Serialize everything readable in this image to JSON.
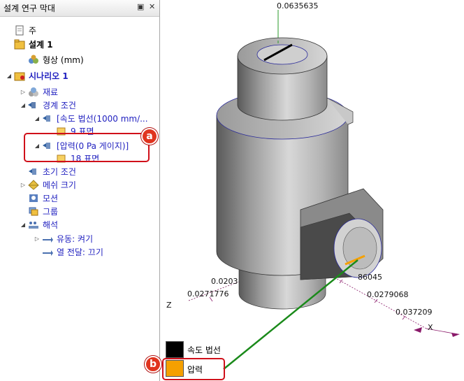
{
  "panel": {
    "title": "설계 연구 막대",
    "pin_icon": "pin-icon",
    "close_glyph": "✕",
    "tree": [
      {
        "label": "주",
        "icon": "document-icon",
        "indent": 0,
        "toggle": ""
      },
      {
        "label": "설계 1",
        "icon": "design-folder-icon",
        "indent": 0,
        "toggle": "",
        "bold": true
      },
      {
        "label": "형상 (mm)",
        "icon": "geometry-icon",
        "indent": 1,
        "toggle": ""
      },
      {
        "label": "시나리오 1",
        "icon": "scenario-icon",
        "indent": 0,
        "toggle": "▲",
        "bold": true,
        "blue": true
      },
      {
        "label": "재료",
        "icon": "materials-icon",
        "indent": 1,
        "toggle": "▷",
        "blue": true
      },
      {
        "label": "경계 조건",
        "icon": "boundary-icon",
        "indent": 1,
        "toggle": "▲",
        "blue": true
      },
      {
        "label": "[속도 법선(1000 mm/...",
        "icon": "boundary-condition-icon",
        "indent": 2,
        "toggle": "▲",
        "blue": true
      },
      {
        "label": "9 표면",
        "icon": "surface-icon",
        "indent": 3,
        "toggle": "",
        "blue": true
      },
      {
        "label": "[압력(0 Pa 게이지)]",
        "icon": "boundary-condition-icon",
        "indent": 2,
        "toggle": "▲",
        "blue": true
      },
      {
        "label": "18 표면",
        "icon": "surface-icon",
        "indent": 3,
        "toggle": "",
        "blue": true
      },
      {
        "label": "초기 조건",
        "icon": "initial-condition-icon",
        "indent": 1,
        "toggle": "",
        "blue": true
      },
      {
        "label": "메쉬 크기",
        "icon": "mesh-icon",
        "indent": 1,
        "toggle": "▷",
        "blue": true
      },
      {
        "label": "모션",
        "icon": "motion-icon",
        "indent": 1,
        "toggle": "",
        "blue": true
      },
      {
        "label": "그룹",
        "icon": "groups-icon",
        "indent": 1,
        "toggle": "",
        "blue": true
      },
      {
        "label": "해석",
        "icon": "solve-icon",
        "indent": 1,
        "toggle": "▲",
        "blue": true
      },
      {
        "label": "유동: 켜기",
        "icon": "flow-icon",
        "indent": 2,
        "toggle": "▷",
        "blue": true
      },
      {
        "label": "열 전달: 끄기",
        "icon": "heat-transfer-icon",
        "indent": 2,
        "toggle": "",
        "blue": true
      }
    ]
  },
  "callouts": {
    "a": "a",
    "b": "b"
  },
  "viewport": {
    "axis_labels": [
      "0.0635635",
      "0.0203",
      "0.0271776",
      "86045",
      "0.0279068",
      "0.037209",
      "Z",
      "X"
    ],
    "legend": [
      {
        "label": "속도 법선",
        "color": "#000000"
      },
      {
        "label": "압력",
        "color": "#f5a000"
      }
    ]
  },
  "colors": {
    "accent_red": "#d0101a",
    "tree_blue": "#2222c0",
    "axis_green": "#2a9a2a",
    "axis_purple": "#8a1a6a"
  }
}
